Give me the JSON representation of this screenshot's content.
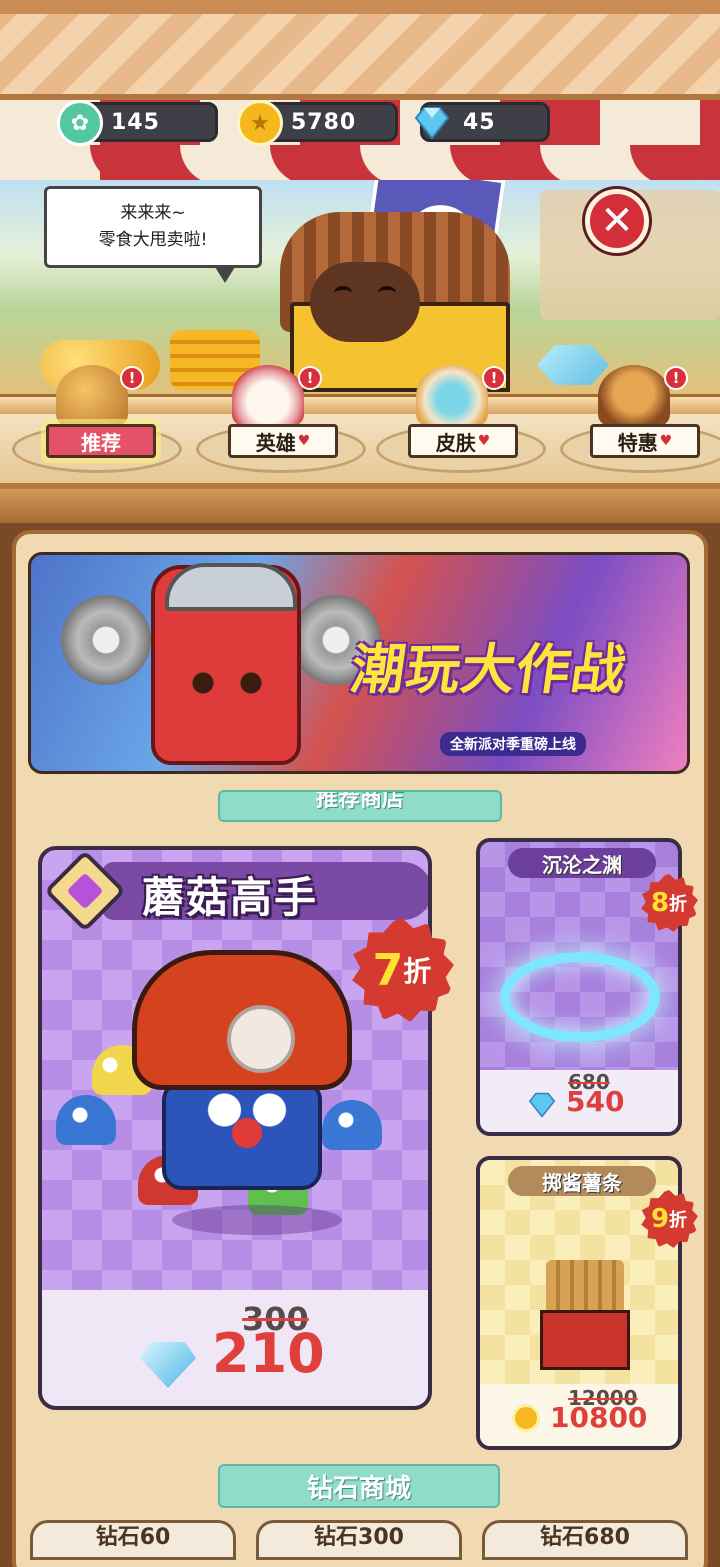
{
  "currencies": [
    {
      "name": "tickets",
      "icon": "green-ticket-icon",
      "value": "145"
    },
    {
      "name": "coins",
      "icon": "gold-coin-icon",
      "value": "5780"
    },
    {
      "name": "diamonds",
      "icon": "diamond-icon",
      "value": "45"
    }
  ],
  "speech_bubble": {
    "line1": "来来来~",
    "line2": "零食大甩卖啦!"
  },
  "close_button": {
    "glyph": "✕"
  },
  "category_tabs": [
    {
      "label": "推荐",
      "active": true,
      "badge": "!"
    },
    {
      "label": "英雄",
      "active": false,
      "badge": "!"
    },
    {
      "label": "皮肤",
      "active": false,
      "badge": "!"
    },
    {
      "label": "特惠",
      "active": false,
      "badge": "!"
    }
  ],
  "banner": {
    "title": "潮玩大作战",
    "subtitle": "全新派对季重磅上线"
  },
  "recommend_section": {
    "title": "推荐商店"
  },
  "featured_item": {
    "name": "蘑菇高手",
    "discount_number": "7",
    "discount_unit": "折",
    "old_price": "300",
    "new_price": "210",
    "currency_icon": "diamond-icon"
  },
  "side_items": [
    {
      "name": "沉沦之渊",
      "discount_number": "8",
      "discount_unit": "折",
      "old_price": "680",
      "new_price": "540",
      "currency_icon": "diamond-icon"
    },
    {
      "name": "掷酱薯条",
      "discount_number": "9",
      "discount_unit": "折",
      "old_price": "12000",
      "new_price": "10800",
      "currency_icon": "gold-coin-icon"
    }
  ],
  "diamond_section": {
    "title": "钻石商城"
  },
  "diamond_packs": [
    {
      "label": "钻石60"
    },
    {
      "label": "钻石300"
    },
    {
      "label": "钻石680"
    }
  ],
  "colors": {
    "accent_red": "#d43a30",
    "teal": "#8fdcc8",
    "purple": "#7a4aa5"
  }
}
